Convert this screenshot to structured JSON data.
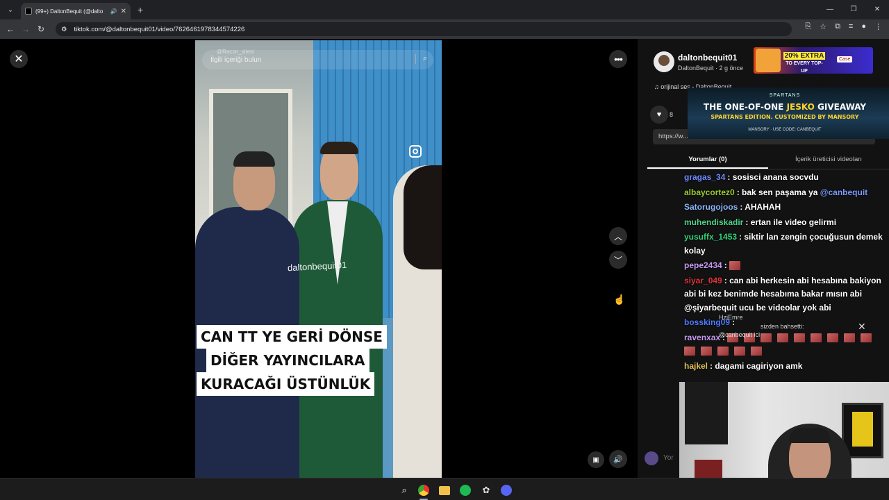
{
  "browser": {
    "tab_title": "(99+) DaltonBequit (@dalto",
    "url": "tiktok.com/@daltonbequit01/video/7626461978344574226"
  },
  "video": {
    "search_small": "@Racon_sitesi",
    "search_placeholder": "İlgili içeriği bulun",
    "watermark": "daltonbequit01",
    "caption_lines": [
      "CAN TT YE GERİ DÖNSE",
      "DİĞER YAYINCILARA",
      "KURACAĞI ÜSTÜNLÜK"
    ]
  },
  "author": {
    "username": "daltonbequit01",
    "sub": "DaltonBequit · 2 g önce",
    "music": "orijinal ses - DaltonBequit",
    "likes": "8",
    "link": "https://w..."
  },
  "tabs": {
    "comments": "Yorumlar (0)",
    "creator_videos": "İçerik üreticisi videoları"
  },
  "comment_input_placeholder": "Yor",
  "ads": {
    "top_line1": "20% EXTRA",
    "top_line2": "TO EVERY TOP-UP",
    "top_brand": "Case",
    "mid_brand": "SPARTANS",
    "mid_head1": "THE ONE-OF-ONE",
    "mid_head_yellow": "JESKO",
    "mid_head2": "GIVEAWAY",
    "mid_head3": "SPARTANS EDITION. CUSTOMIZED BY MANSORY",
    "mid_foot": "MANSORY  ·  USE CODE: CANBEQUIT"
  },
  "chat": [
    {
      "user": "gragas_34",
      "color": "#6f8bff",
      "text": ": sosisci anana socvdu"
    },
    {
      "user": "albaycortez0",
      "color": "#9acd32",
      "text": ": bak sen paşama ya",
      "mention": "@canbequit"
    },
    {
      "user": "Satorugojoos",
      "color": "#8ab4f8",
      "text": ": AHAHAH"
    },
    {
      "user": "muhendiskadir",
      "color": "#4ed28a",
      "text": ": ertan ile video gelirmi"
    },
    {
      "user": "yusuffx_1453",
      "color": "#33d17a",
      "text": ": siktir lan zengin çocuğusun demek kolay"
    },
    {
      "user": "pepe2434",
      "color": "#c59af0",
      "text": ":"
    },
    {
      "user": "siyar_049",
      "color": "#e0353b",
      "text": ": can abi herkesin abi hesabına bakiyon abi bi kez benimde hesabıma bakar mısın abi @şiyarbequit ucu be videolar yok abi"
    },
    {
      "user": "bossking09",
      "color": "#4d7bff",
      "text": ":"
    },
    {
      "user": "ravenxax",
      "color": "#c59af0",
      "text": ":"
    },
    {
      "user": "hajkel",
      "color": "#e0c25a",
      "text": ": dagami cagiriyon amk"
    }
  ],
  "notification": {
    "text": "sizden bahsetti:",
    "sub": "@canbequit ici",
    "name": "HziEmre"
  }
}
